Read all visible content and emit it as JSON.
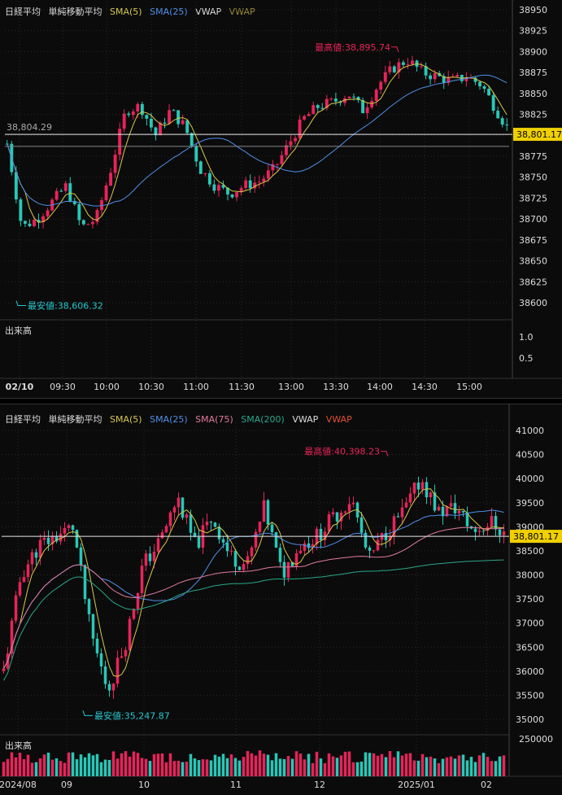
{
  "top": {
    "legend": [
      {
        "label": "日経平均",
        "color": "#e0e0e0"
      },
      {
        "label": "単純移動平均",
        "color": "#e0e0e0"
      },
      {
        "label": "SMA(5)",
        "color": "#d8c84a"
      },
      {
        "label": "SMA(25)",
        "color": "#4f8fe8"
      },
      {
        "label": "VWAP",
        "color": "#e0e0e0"
      },
      {
        "label": "VWAP",
        "color": "#9a8a30"
      }
    ],
    "volume_label": "出来高",
    "current_price": "38,801.17",
    "ref_price": "38,804.29",
    "high_label": "最高値:38,895.74",
    "low_label": "最安値:38,606.32",
    "y_ticks": [
      "38950",
      "38925",
      "38900",
      "38875",
      "38850",
      "38825",
      "38800",
      "38775",
      "38750",
      "38725",
      "38700",
      "38675",
      "38650",
      "38625",
      "38600"
    ],
    "vol_ticks": [
      "1.0",
      "0.5"
    ],
    "x_ticks": [
      "02/10",
      "09:30",
      "10:00",
      "10:30",
      "11:00",
      "11:30",
      "13:00",
      "13:30",
      "14:00",
      "14:30",
      "15:00"
    ]
  },
  "bottom": {
    "legend": [
      {
        "label": "日経平均",
        "color": "#e0e0e0"
      },
      {
        "label": "単純移動平均",
        "color": "#e0e0e0"
      },
      {
        "label": "SMA(5)",
        "color": "#d8c84a"
      },
      {
        "label": "SMA(25)",
        "color": "#4f8fe8"
      },
      {
        "label": "SMA(75)",
        "color": "#e07aa0"
      },
      {
        "label": "SMA(200)",
        "color": "#2aa888"
      },
      {
        "label": "VWAP",
        "color": "#e0e0e0"
      },
      {
        "label": "VWAP",
        "color": "#e05030"
      }
    ],
    "volume_label": "出来高",
    "current_price": "38,801.17",
    "high_label": "最高値:40,398.23",
    "low_label": "最安値:35,247.87",
    "y_ticks": [
      "41000",
      "40500",
      "40000",
      "39500",
      "39000",
      "38500",
      "38000",
      "37500",
      "37000",
      "36500",
      "36000",
      "35500",
      "35000"
    ],
    "vol_tick": "250000",
    "x_ticks": [
      "2024/08",
      "09",
      "10",
      "11",
      "12",
      "2025/01",
      "02"
    ]
  },
  "colors": {
    "up": "#e8245a",
    "down": "#28c8b8",
    "grid": "#2a2a2a",
    "price_line": "#e8e8e8",
    "tag_bg": "#f0d000",
    "tag_text": "#000000",
    "high_text": "#e8245a",
    "low_text": "#28c8d0"
  },
  "chart_data": [
    {
      "type": "candlestick",
      "title": "日経平均",
      "interval": "intraday 02/10",
      "ylim": [
        38600,
        38950
      ],
      "high": 38895.74,
      "low": 38606.32,
      "last": 38801.17,
      "ref": 38804.29,
      "close_path": [
        38790,
        38690,
        38700,
        38720,
        38740,
        38690,
        38700,
        38760,
        38830,
        38835,
        38800,
        38830,
        38810,
        38760,
        38740,
        38730,
        38740,
        38745,
        38760,
        38790,
        38820,
        38835,
        38840,
        38850,
        38830,
        38860,
        38880,
        38890,
        38875,
        38870,
        38865,
        38870,
        38860,
        38830,
        38801
      ]
    },
    {
      "type": "candlestick",
      "title": "日経平均",
      "interval": "daily 2024/08 - 2025/02",
      "ylim": [
        35000,
        41000
      ],
      "high": 40398.23,
      "low": 35247.87,
      "last": 38801.17,
      "close_path": [
        36000,
        38000,
        38600,
        38800,
        39000,
        36800,
        35600,
        36600,
        38200,
        38700,
        39600,
        38600,
        39200,
        38400,
        38200,
        39400,
        38000,
        38600,
        38800,
        39200,
        39600,
        38300,
        38900,
        39300,
        40000,
        39300,
        39400,
        38900,
        39100,
        38801
      ]
    }
  ]
}
